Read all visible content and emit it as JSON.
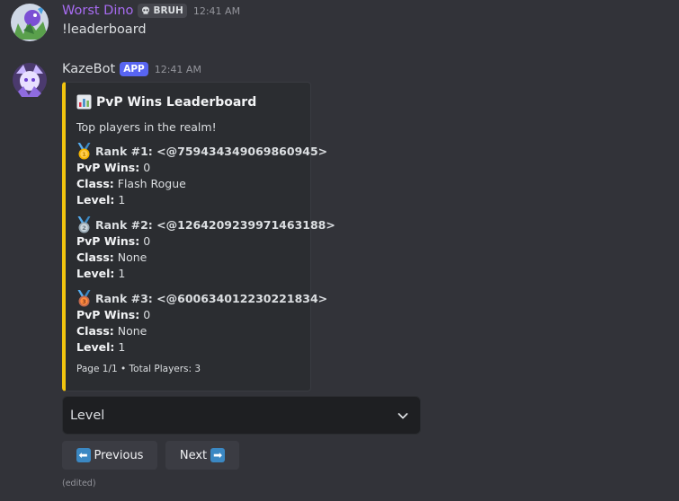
{
  "messages": [
    {
      "username": "Worst Dino",
      "username_color": "#a86cf2",
      "tag": "BRUH",
      "tag_icon": "skull-icon",
      "timestamp": "12:41 AM",
      "content": "!leaderboard"
    },
    {
      "username": "KazeBot",
      "username_color": "#dbdee1",
      "tag": "APP",
      "timestamp": "12:41 AM",
      "embed": {
        "accent_color": "#f1c40f",
        "title_icon": "bar-chart-icon",
        "title": "PvP Wins Leaderboard",
        "description": "Top players in the realm!",
        "entries": [
          {
            "medal": "gold-medal-icon",
            "rank": "Rank #1: <@759434349069860945>",
            "wins_label": "PvP Wins:",
            "wins": "0",
            "class_label": "Class:",
            "class": "Flash Rogue",
            "level_label": "Level:",
            "level": "1"
          },
          {
            "medal": "silver-medal-icon",
            "rank": "Rank #2: <@1264209239971463188>",
            "wins_label": "PvP Wins:",
            "wins": "0",
            "class_label": "Class:",
            "class": "None",
            "level_label": "Level:",
            "level": "1"
          },
          {
            "medal": "bronze-medal-icon",
            "rank": "Rank #3: <@600634012230221834>",
            "wins_label": "PvP Wins:",
            "wins": "0",
            "class_label": "Class:",
            "class": "None",
            "level_label": "Level:",
            "level": "1"
          }
        ],
        "footer": "Page 1/1 • Total Players: 3"
      },
      "select": {
        "value": "Level"
      },
      "buttons": {
        "previous": {
          "icon": "left-arrow-icon",
          "label": "Previous"
        },
        "next": {
          "icon": "right-arrow-icon",
          "label": "Next"
        }
      },
      "edited": "(edited)"
    }
  ]
}
